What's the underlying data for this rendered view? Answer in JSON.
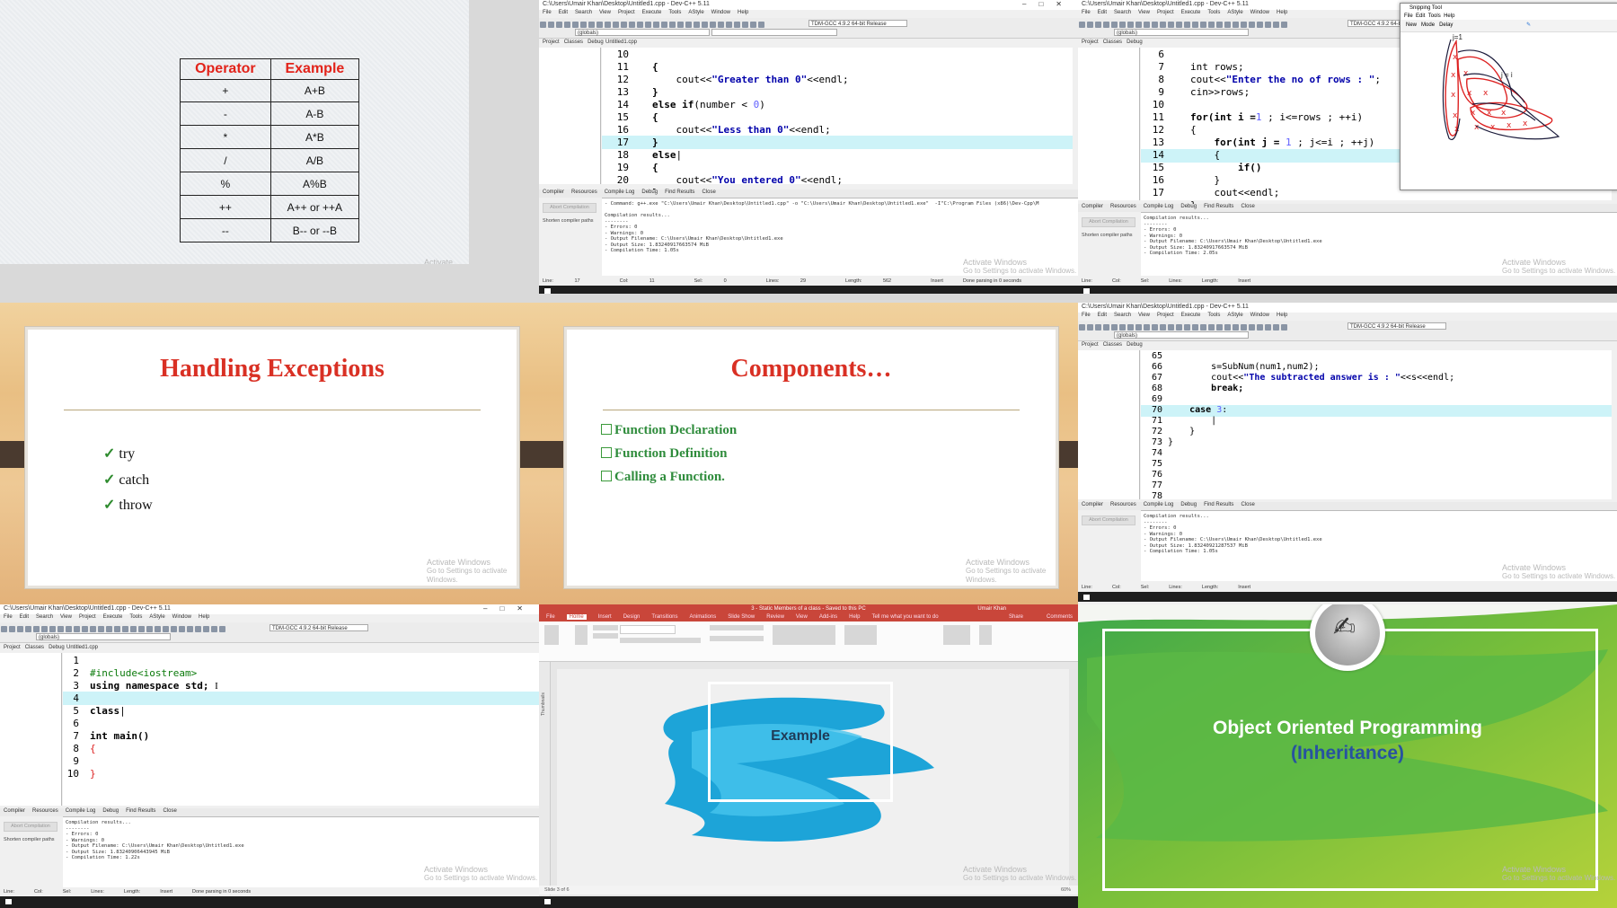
{
  "watermark": {
    "line1": "Activate Windows",
    "line2": "Go to Settings to activate Windows."
  },
  "operator_table": {
    "headers": [
      "Operator",
      "Example"
    ],
    "rows": [
      [
        "+",
        "A+B"
      ],
      [
        "-",
        "A-B"
      ],
      [
        "*",
        "A*B"
      ],
      [
        "/",
        "A/B"
      ],
      [
        "%",
        "A%B"
      ],
      [
        "++",
        "A++ or ++A"
      ],
      [
        "--",
        "B-- or --B"
      ]
    ]
  },
  "ide": {
    "title": "C:\\Users\\Umair Khan\\Desktop\\Untitled1.cpp - Dev-C++ 5.11",
    "menu": [
      "File",
      "Edit",
      "Search",
      "View",
      "Project",
      "Execute",
      "Tools",
      "AStyle",
      "Window",
      "Help"
    ],
    "compiler": "TDM-GCC 4.9.2 64-bit Release",
    "globals": "(globals)",
    "left_tabs": [
      "Project",
      "Classes",
      "Debug"
    ],
    "file_tab": "Untitled1.cpp",
    "bottom_tabs": [
      "Compiler",
      "Resources",
      "Compile Log",
      "Debug",
      "Find Results",
      "Close"
    ],
    "abort": "Abort Compilation",
    "shorten": "Shorten compiler paths",
    "status": {
      "line": "Line:",
      "col": "Col:",
      "sel": "Sel:",
      "lines": "Lines:",
      "length": "Length:",
      "insert": "Insert",
      "done": "Done parsing in 0 seconds"
    }
  },
  "ide1": {
    "lines": [
      "10",
      "11",
      "12",
      "13",
      "14",
      "15",
      "16",
      "17",
      "18",
      "19",
      "20"
    ],
    "code": {
      "l10": "{",
      "l11a": "    cout<<",
      "l11b": "\"Greater than 0\"",
      "l11c": "<<endl;",
      "l12": "}",
      "l13a": "else if",
      "l13b": "(number < ",
      "l13c": "0",
      "l13d": ")",
      "l14": "{",
      "l15a": "    cout<<",
      "l15b": "\"Less than 0\"",
      "l15c": "<<endl;",
      "l16": "}",
      "l17": "else",
      "l18": "{",
      "l19a": "    cout<<",
      "l19b": "\"You entered 0\"",
      "l19c": "<<endl;",
      "l20": "}"
    },
    "log": "- Command: g++.exe \"C:\\Users\\Umair Khan\\Desktop\\Untitled1.cpp\" -o \"C:\\Users\\Umair Khan\\Desktop\\Untitled1.exe\"  -I\"C:\\Program Files (x86)\\Dev-Cpp\\M\n\nCompilation results...\n--------\n- Errors: 0\n- Warnings: 0\n- Output Filename: C:\\Users\\Umair Khan\\Desktop\\Untitled1.exe\n- Output Size: 1.83240917663574 MiB\n- Compilation Time: 1.05s",
    "status_vals": [
      "17",
      "11",
      "0",
      "29",
      "562"
    ]
  },
  "ide2": {
    "lines": [
      "6",
      "7",
      "8",
      "9",
      "10",
      "11",
      "12",
      "13",
      "14",
      "15",
      "16",
      "17"
    ],
    "code": {
      "l6": "int rows;",
      "l7a": "cout<<",
      "l7b": "\"Enter the no of rows : \"",
      "l7c": ";",
      "l8": "cin>>rows;",
      "l10a": "for(int i =",
      "l10b": "1",
      "l10c": " ; i<=rows ; ++i)",
      "l11": "{",
      "l12a": "    for(int j = ",
      "l12b": "1",
      "l12c": " ; j<=i ; ++j)",
      "l13": "    {",
      "l14": "        if()",
      "l15": "    }",
      "l16": "    cout<<endl;",
      "l17": "}"
    },
    "log": "Compilation results...\n--------\n- Errors: 0\n- Warnings: 0\n- Output Filename: C:\\Users\\Umair Khan\\Desktop\\Untitled1.exe\n- Output Size: 1.83240917663574 MiB\n- Compilation Time: 2.05s",
    "snip_title": "Snipping Tool",
    "snip_menu": [
      "File",
      "Edit",
      "Tools",
      "Help"
    ],
    "snip_tools": [
      "New",
      "Mode",
      "Delay"
    ],
    "snip_labels": [
      "j=1",
      "j = i"
    ]
  },
  "ide3": {
    "lines": [
      "65",
      "66",
      "67",
      "68",
      "69",
      "70",
      "71",
      "72",
      "73",
      "74",
      "75",
      "76",
      "77",
      "78"
    ],
    "code": {
      "l65": "        s=SubNum(num1,num2);",
      "l66a": "        cout<<",
      "l66b": "\"The subtracted answer is : \"",
      "l66c": "<<s<<endl;",
      "l67": "        break;",
      "l69a": "    case ",
      "l69b": "3",
      ":": ":",
      "l71": "    }",
      "l72": "}"
    },
    "log": "Compilation results...\n--------\n- Errors: 0\n- Warnings: 0\n- Output Filename: C:\\Users\\Umair Khan\\Desktop\\Untitled1.exe\n- Output Size: 1.83240921287537 MiB\n- Compilation Time: 1.05s"
  },
  "ide4": {
    "title": "C:\\Users\\Umair Khan\\Desktop\\Untitled1.cpp - Dev-C++ 5.11",
    "lines": [
      "1",
      "2",
      "3",
      "4",
      "5",
      "6",
      "7",
      "8",
      "9",
      "10"
    ],
    "code": {
      "l1": "#include<iostream>",
      "l2": "using namespace std;",
      "l4": "class",
      "l6": "int main()",
      "l7": "{",
      "l9": "}"
    },
    "log": "Compilation results...\n--------\n- Errors: 0\n- Warnings: 0\n- Output Filename: C:\\Users\\Umair Khan\\Desktop\\Untitled1.exe\n- Output Size: 1.83240906443945 MiB\n- Compilation Time: 1.22s"
  },
  "slide_exceptions": {
    "title": "Handling Exceptions",
    "items": [
      "try",
      "catch",
      "throw"
    ]
  },
  "slide_components": {
    "title": "Components…",
    "items": [
      "Function Declaration",
      "Function Definition",
      "Calling a Function."
    ]
  },
  "ppt": {
    "title": "3 - Static Members of a class - Saved to this PC",
    "user": "Umair Khan",
    "menu": [
      "File",
      "Home",
      "Insert",
      "Design",
      "Transitions",
      "Animations",
      "Slide Show",
      "Review",
      "View",
      "Add-ins",
      "Help",
      "Tell me what you want to do"
    ],
    "share": "Share",
    "comments": "Comments",
    "slide_text": "Example",
    "status": "Slide 3 of 6",
    "thumbs": "Thumbnails",
    "zoom": "60%"
  },
  "inheritance": {
    "line1": "Object Oriented Programming",
    "line2": "(Inheritance)"
  },
  "colors": {
    "red": "#d93024",
    "green": "#2f8c3c",
    "blue": "#1da4d8",
    "highlight": "#cdf3f8"
  },
  "icons": [
    "check-icon",
    "square-bullet-icon",
    "windows-start-icon",
    "pen-icon"
  ]
}
